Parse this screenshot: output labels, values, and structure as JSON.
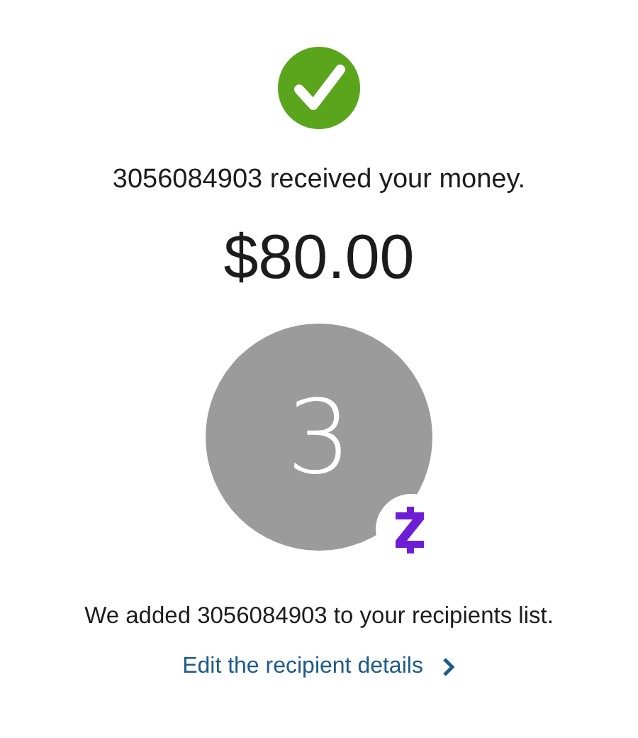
{
  "status": {
    "message": "3056084903 received your money.",
    "amount": "$80.00"
  },
  "recipient": {
    "initial": "3"
  },
  "note": "We added 3056084903 to your recipients list.",
  "link": {
    "label": "Edit the recipient details"
  }
}
